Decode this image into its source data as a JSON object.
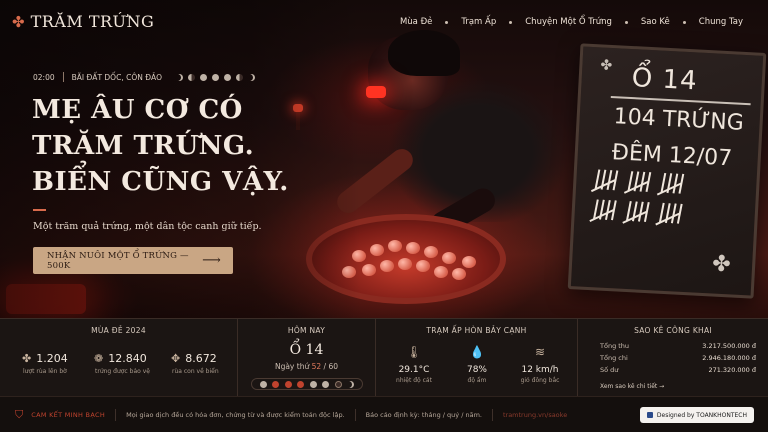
{
  "brand": {
    "name": "TRĂM TRỨNG",
    "icon": "turtle-icon"
  },
  "nav": {
    "items": [
      "Mùa Đẻ",
      "Trạm Ấp",
      "Chuyện Một Ổ Trứng",
      "Sao Kê",
      "Chung Tay"
    ]
  },
  "hero": {
    "time": "02:00",
    "location": "BÃI ĐẤT DỐC, CÔN ĐẢO",
    "headline": [
      "MẸ ÂU CƠ CÓ",
      "TRĂM TRỨNG.",
      "BIỂN CŨNG VẬY."
    ],
    "subtitle": "Một trăm quả trứng, một dân tộc canh giữ tiếp.",
    "cta_label": "NHẬN NUÔI MỘT Ổ TRỨNG — 500K",
    "cta_icon": "arrow-right-icon"
  },
  "chalkboard": {
    "nest": "Ổ 14",
    "eggs": "104 TRỨNG",
    "night": "ĐÊM 12/07"
  },
  "season": {
    "title": "MÙA ĐẺ 2024",
    "items": [
      {
        "icon": "turtle-icon",
        "value": "1.204",
        "label": "lượt rùa lên bờ"
      },
      {
        "icon": "eggs-icon",
        "value": "12.840",
        "label": "trứng được bảo vệ"
      },
      {
        "icon": "hatchling-icon",
        "value": "8.672",
        "label": "rùa con về biển"
      }
    ]
  },
  "today": {
    "title": "HÔM NAY",
    "nest": "Ổ 14",
    "night_prefix": "Ngày thứ",
    "night_current": "52",
    "night_total": "/ 60"
  },
  "station": {
    "title": "TRẠM ẤP HÒN BẢY CẠNH",
    "items": [
      {
        "icon": "thermometer-icon",
        "value": "29.1°C",
        "label": "nhiệt độ cát"
      },
      {
        "icon": "droplet-icon",
        "value": "78%",
        "label": "độ ẩm"
      },
      {
        "icon": "wind-icon",
        "value": "12 km/h",
        "label": "gió đông bắc"
      }
    ]
  },
  "ledger": {
    "title": "SAO KÊ CÔNG KHAI",
    "rows": [
      {
        "label": "Tổng thu",
        "value": "3.217.500.000 đ"
      },
      {
        "label": "Tổng chi",
        "value": "2.946.180.000 đ"
      },
      {
        "label": "Số dư",
        "value": "271.320.000 đ"
      }
    ],
    "link": "Xem sao kê chi tiết →"
  },
  "footer": {
    "commit": "CAM KẾT MINH BẠCH",
    "text1": "Mọi giao dịch đều có hóa đơn, chứng từ và được kiểm toán độc lập.",
    "text2": "Báo cáo định kỳ: tháng / quý / năm.",
    "link": "tramtrung.vn/saoke",
    "badge": "Designed by TOANKHONTECH"
  },
  "colors": {
    "accent": "#d86b4c",
    "cta_bg": "#c9a684",
    "panel_bg": "#1b1513"
  }
}
